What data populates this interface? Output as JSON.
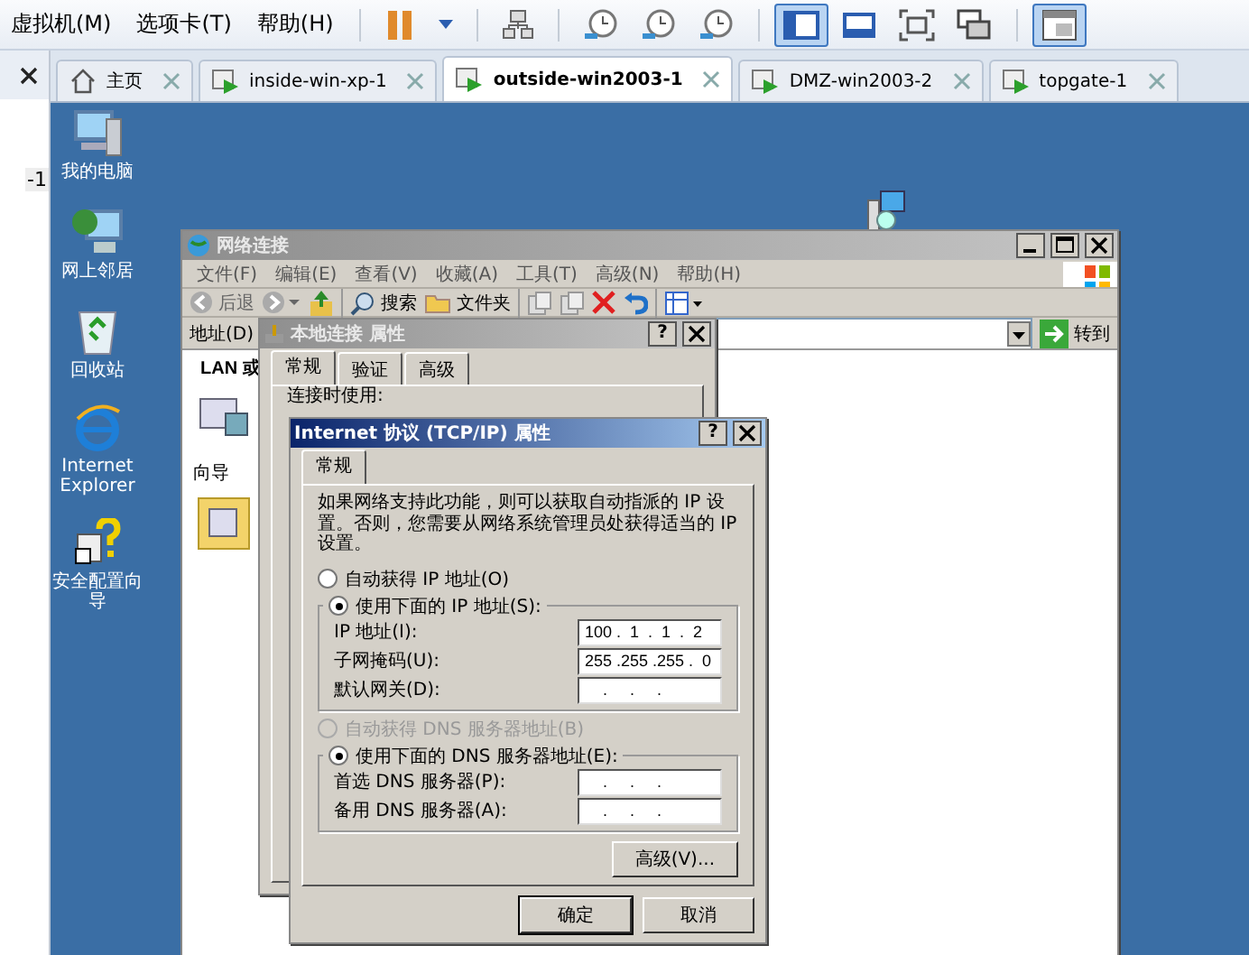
{
  "menu_bar": {
    "items": [
      "虚拟机(M)",
      "选项卡(T)",
      "帮助(H)"
    ],
    "toolbar_groups": [
      {
        "buttons": [
          {
            "kind": "pause",
            "selected": false
          },
          {
            "kind": "caret",
            "selected": false
          }
        ]
      },
      {
        "buttons": [
          {
            "kind": "tree",
            "selected": false
          }
        ]
      },
      {
        "buttons": [
          {
            "kind": "clock",
            "selected": false
          },
          {
            "kind": "clock",
            "selected": false
          },
          {
            "kind": "clock",
            "selected": false
          }
        ]
      },
      {
        "buttons": [
          {
            "kind": "sidebar",
            "selected": true
          },
          {
            "kind": "console",
            "selected": false
          },
          {
            "kind": "fullscreen",
            "selected": false
          },
          {
            "kind": "windows",
            "selected": false
          }
        ]
      },
      {
        "buttons": [
          {
            "kind": "thumbs",
            "selected": true
          }
        ]
      }
    ]
  },
  "sidebar": {
    "item": "-1"
  },
  "tabs": [
    {
      "label": "主页",
      "kind": "home",
      "selected": false
    },
    {
      "label": "inside-win-xp-1",
      "kind": "vm",
      "selected": false
    },
    {
      "label": "outside-win2003-1",
      "kind": "vm",
      "selected": true
    },
    {
      "label": "DMZ-win2003-2",
      "kind": "vm",
      "selected": false
    },
    {
      "label": "topgate-1",
      "kind": "vm",
      "selected": false
    }
  ],
  "desktop": {
    "icons": [
      {
        "label": "我的电脑",
        "kind": "computer"
      },
      {
        "label": "网上邻居",
        "kind": "network"
      },
      {
        "label": "回收站",
        "kind": "recycle"
      },
      {
        "label": "Internet Explorer",
        "kind": "ie"
      },
      {
        "label": "安全配置向导",
        "kind": "wizard"
      }
    ],
    "loose_icon": {
      "kind": "setup"
    }
  },
  "network_window": {
    "title": "网络连接",
    "active": false,
    "menu": [
      "文件(F)",
      "编辑(E)",
      "查看(V)",
      "收藏(A)",
      "工具(T)",
      "高级(N)",
      "帮助(H)"
    ],
    "toolbar": {
      "back": "后退",
      "search": "搜索",
      "folders": "文件夹"
    },
    "address": {
      "label": "地址(D)",
      "go": "转到"
    },
    "content": {
      "group_heading": "LAN 或",
      "side_heading": "向导"
    }
  },
  "properties_dialog": {
    "title": "本地连接 属性",
    "active": false,
    "help": "?",
    "tabs": [
      {
        "label": "常规",
        "selected": true
      },
      {
        "label": "验证",
        "selected": false
      },
      {
        "label": "高级",
        "selected": false
      }
    ],
    "connect_using": "连接时使用:"
  },
  "tcpip_dialog": {
    "title": "Internet 协议 (TCP/IP) 属性",
    "active": true,
    "help": "?",
    "tabs": [
      {
        "label": "常规",
        "selected": true
      }
    ],
    "intro": "如果网络支持此功能，则可以获取自动指派的 IP 设置。否则，您需要从网络系统管理员处获得适当的 IP 设置。",
    "ip_auto": {
      "label": "自动获得 IP 地址(O)",
      "selected": false,
      "disabled": false
    },
    "ip_manual": {
      "label": "使用下面的 IP 地址(S):",
      "selected": true,
      "disabled": false
    },
    "ip_fields": [
      {
        "label": "IP 地址(I):",
        "value": "100 .  1  .  1  .  2"
      },
      {
        "label": "子网掩码(U):",
        "value": "255 .255 .255 .  0"
      },
      {
        "label": "默认网关(D):",
        "value": "    .     .     ."
      }
    ],
    "dns_auto": {
      "label": "自动获得 DNS 服务器地址(B)",
      "selected": false,
      "disabled": true
    },
    "dns_manual": {
      "label": "使用下面的 DNS 服务器地址(E):",
      "selected": true,
      "disabled": false
    },
    "dns_fields": [
      {
        "label": "首选 DNS 服务器(P):",
        "value": "    .     .     ."
      },
      {
        "label": "备用 DNS 服务器(A):",
        "value": "    .     .     ."
      }
    ],
    "advanced_button": "高级(V)...",
    "ok_button": "确定",
    "cancel_button": "取消"
  }
}
